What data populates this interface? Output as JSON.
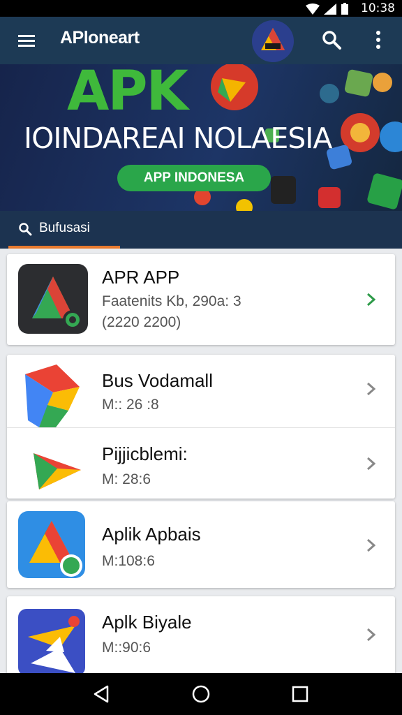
{
  "status_bar": {
    "time": "10:38"
  },
  "app_bar": {
    "title": "APloneart"
  },
  "banner": {
    "logo_text": "APK",
    "headline": "IOINDAREAI NOLAESIA",
    "pill_label": "APP INDONESA"
  },
  "tab": {
    "label": "Bufusasi"
  },
  "featured": {
    "name": "APR APP",
    "line1": "Faatenits Kb, 290a: 3",
    "line2": "(2220 2200)"
  },
  "apps": [
    {
      "name": "Bus Vodamall",
      "meta": "M:: 26 :8"
    },
    {
      "name": "Pijjicblemi:",
      "meta": "M: 28:6"
    },
    {
      "name": "Aplik Apbais",
      "meta": "M:108:6"
    },
    {
      "name": "Aplk Biyale",
      "meta": "M::90:6"
    }
  ],
  "colors": {
    "app_bar": "#1d3a55",
    "tab_underline": "#e87a2f",
    "chevron_featured": "#2e9b49",
    "chevron": "#888888"
  }
}
